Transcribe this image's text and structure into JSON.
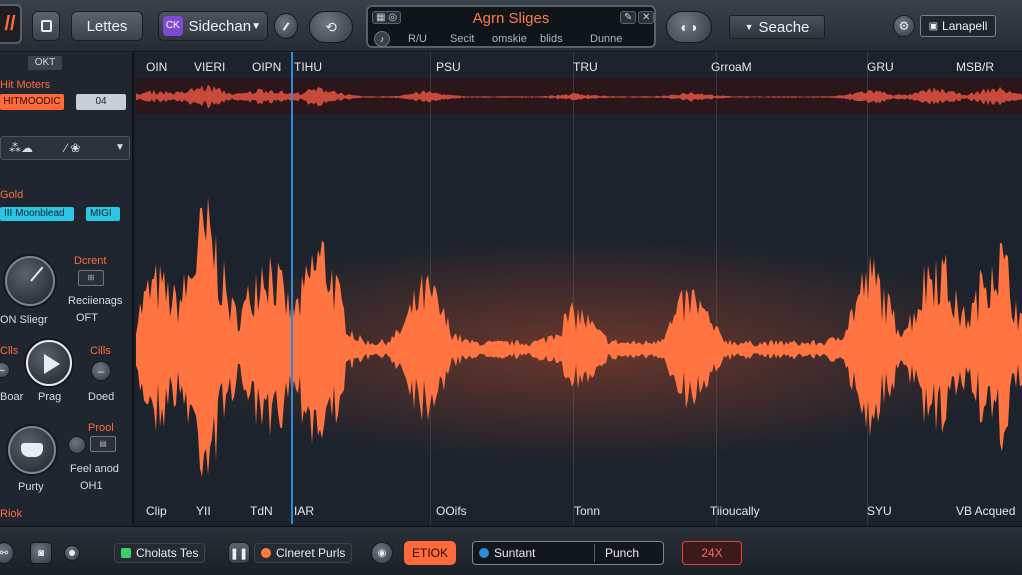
{
  "colors": {
    "accent": "#ff6a3d",
    "highlight": "#2ec6e6",
    "playhead": "#2d8ad6",
    "lcd_title": "#ff7a45"
  },
  "toolbar": {
    "logo": "//",
    "letters_label": "Lettes",
    "sidechain_label": "Sidechan",
    "search_label": "Seache",
    "layout_label": "Lanapell"
  },
  "lcd": {
    "title": "Agrn Sliges",
    "row": [
      "R/U",
      "Secit",
      "omskie",
      "blids",
      "Dunne"
    ]
  },
  "markers_top": [
    "OIN",
    "VIERI",
    "OIPN",
    "TIHU",
    "PSU",
    "TRU",
    "GrroaM",
    "GRU",
    "MSB/R"
  ],
  "markers_bottom": [
    "Clip",
    "YII",
    "TdN",
    "IAR",
    "OOifs",
    "Tonn",
    "Tiioucally",
    "SYU",
    "VB Acqued"
  ],
  "sidebar": {
    "header": "OKT",
    "meters_label": "Hit Moters",
    "hit_badge": "HITMOODIC",
    "value_field": "04",
    "gold_label": "Gold",
    "mode_badge": "III Moonblead",
    "mode_value": "MIGI",
    "knob1_label": "ON Sliegr",
    "dcrent_label": "Dcrent",
    "reciences_label": "Reciienags",
    "off_label": "OFT",
    "calls_left": "Clls",
    "calls_right": "Cills",
    "boar_label": "Boar",
    "prag_label": "Prag",
    "doed_label": "Doed",
    "prool_label": "Prool",
    "purty_label": "Purty",
    "feel_label": "Feel anod",
    "ofh_label": "OH1",
    "bottom_label": "Riok"
  },
  "bottombar": {
    "chips_label": "Cholats Tes",
    "preset_label": "Clneret Purls",
    "stop_label": "ETIOK",
    "instrument_label": "Suntant",
    "punch_label": "Punch",
    "zoom_label": "24X"
  },
  "waveform": {
    "type": "audio-waveform",
    "segments": [
      "sparse intro",
      "dense main",
      "taper"
    ]
  }
}
